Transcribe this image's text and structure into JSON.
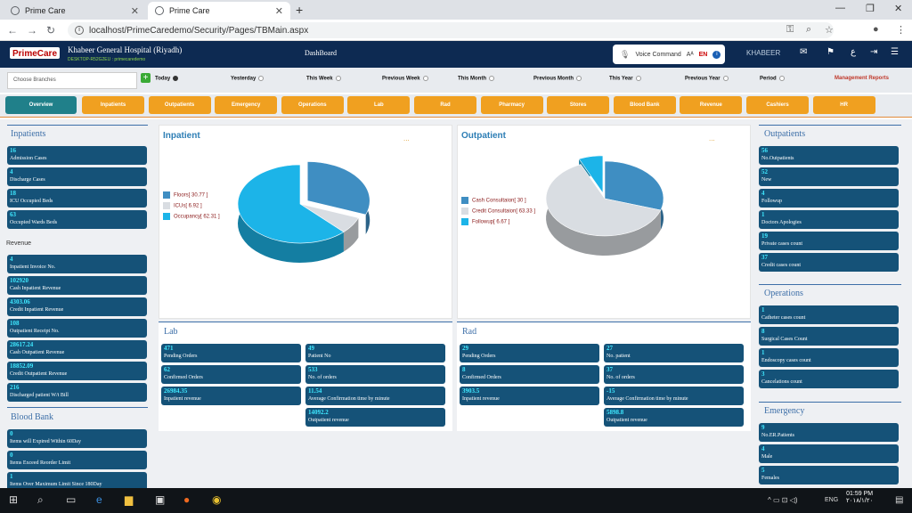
{
  "browser": {
    "tabs": [
      "Prime Care",
      "Prime Care"
    ],
    "url": "localhost/PrimeCaredemo/Security/Pages/TBMain.aspx"
  },
  "header": {
    "logo": "PrimeCare",
    "hospital": "Khabeer General Hospital (Riyadh)",
    "host": "DESKTOP-R52G2EU : primecaredemo",
    "title": "DashBoard",
    "voice": "Voice Command",
    "lang": "EN",
    "user": "KHABEER"
  },
  "filters": {
    "branch_placeholder": "Choose Branches",
    "periods": [
      "Today",
      "Yesterday",
      "This Week",
      "Previous Week",
      "This Month",
      "Previous Month",
      "This Year",
      "Previous Year",
      "Period"
    ],
    "selected": "Today",
    "reports": "Management Reports"
  },
  "modules": [
    "Overview",
    "Inpatients",
    "Outpatients",
    "Emergency",
    "Operations",
    "Lab",
    "Rad",
    "Pharmacy",
    "Stores",
    "Blood Bank",
    "Revenue",
    "Cashiers",
    "HR"
  ],
  "inpatients": {
    "title": "Inpatients",
    "stats": [
      {
        "v": "16",
        "l": "Admission Cases"
      },
      {
        "v": "4",
        "l": "Discharge Cases"
      },
      {
        "v": "18",
        "l": "ICU Occupied Beds"
      },
      {
        "v": "63",
        "l": "Occupied Wards Beds"
      }
    ]
  },
  "revenue": {
    "title": "Revenue",
    "stats": [
      {
        "v": "4",
        "l": "Inpatient Invoice No."
      },
      {
        "v": "102920",
        "l": "Cash Inpatient Revenue"
      },
      {
        "v": "4303.06",
        "l": "Credit Inpatient Revenue"
      },
      {
        "v": "108",
        "l": "Outpatient Receipt No."
      },
      {
        "v": "28617.24",
        "l": "Cash Outpatient Revenue"
      },
      {
        "v": "18852.09",
        "l": "Credit Outpatient Revenue"
      },
      {
        "v": "216",
        "l": "Discharged patient W/t Bill"
      }
    ]
  },
  "bloodbank": {
    "title": "Blood Bank",
    "stats": [
      {
        "v": "0",
        "l": "Items will Expired Within 60Day"
      },
      {
        "v": "0",
        "l": "Items Exceed Reorder Limit"
      },
      {
        "v": "1",
        "l": "Items Over Maximum Limit Since 180Day"
      }
    ]
  },
  "inpatient_chart": {
    "title": "Inpatient",
    "legend": [
      "Floors[ 30.77 ]",
      "ICUs[ 6.92 ]",
      "Occupancy[ 62.31 ]"
    ]
  },
  "outpatient_chart": {
    "title": "Outpatient",
    "legend": [
      "Cash Consultaion[ 30 ]",
      "Credit Consultaion[ 63.33 ]",
      "Followup[ 6.67 ]"
    ]
  },
  "chart_data": [
    {
      "type": "pie",
      "title": "Inpatient",
      "categories": [
        "Floors",
        "ICUs",
        "Occupancy"
      ],
      "values": [
        30.77,
        6.92,
        62.31
      ],
      "colors": [
        "#3f8ec2",
        "#d9dde2",
        "#1cb4e8"
      ]
    },
    {
      "type": "pie",
      "title": "Outpatient",
      "categories": [
        "Cash Consultaion",
        "Credit Consultaion",
        "Followup"
      ],
      "values": [
        30,
        63.33,
        6.67
      ],
      "colors": [
        "#3f8ec2",
        "#d9dde2",
        "#1cb4e8"
      ]
    }
  ],
  "lab": {
    "title": "Lab",
    "left": [
      {
        "v": "471",
        "l": "Pending Orders"
      },
      {
        "v": "62",
        "l": "Confirmed Orders"
      },
      {
        "v": "26984.35",
        "l": "Inpatient revenue"
      }
    ],
    "right": [
      {
        "v": "49",
        "l": "Patient No"
      },
      {
        "v": "533",
        "l": "No. of orders"
      },
      {
        "v": "11.54",
        "l": "Average Confirmation time by minute"
      },
      {
        "v": "14092.2",
        "l": "Outpatient revenue"
      }
    ]
  },
  "rad": {
    "title": "Rad",
    "left": [
      {
        "v": "29",
        "l": "Pending Orders"
      },
      {
        "v": "8",
        "l": "Confirmed Orders"
      },
      {
        "v": "3903.5",
        "l": "Inpatient revenue"
      }
    ],
    "right": [
      {
        "v": "27",
        "l": "No. patient"
      },
      {
        "v": "37",
        "l": "No. of orders"
      },
      {
        "v": "-15",
        "l": "Average Confirmation time by minute"
      },
      {
        "v": "5898.8",
        "l": "Outpatient revenue"
      }
    ]
  },
  "outpatients": {
    "title": "Outpatients",
    "stats": [
      {
        "v": "56",
        "l": "No.Outpatients"
      },
      {
        "v": "52",
        "l": "New"
      },
      {
        "v": "4",
        "l": "Followup"
      },
      {
        "v": "1",
        "l": "Doctors Apologies"
      },
      {
        "v": "19",
        "l": "Private cases count"
      },
      {
        "v": "37",
        "l": "Credit cases count"
      }
    ]
  },
  "operations": {
    "title": "Operations",
    "stats": [
      {
        "v": "1",
        "l": "Catheter cases count"
      },
      {
        "v": "8",
        "l": "Surgical Cases Count"
      },
      {
        "v": "1",
        "l": "Endoscopy cases count"
      },
      {
        "v": "3",
        "l": "Cancelations count"
      }
    ]
  },
  "emergency": {
    "title": "Emergency",
    "stats": [
      {
        "v": "9",
        "l": "No.ER.Patients"
      },
      {
        "v": "4",
        "l": "Male"
      },
      {
        "v": "5",
        "l": "Females"
      }
    ]
  },
  "taskbar": {
    "lang": "ENG",
    "time": "01:59 PM",
    "date": "٢٠١٨/١/٢٠"
  }
}
